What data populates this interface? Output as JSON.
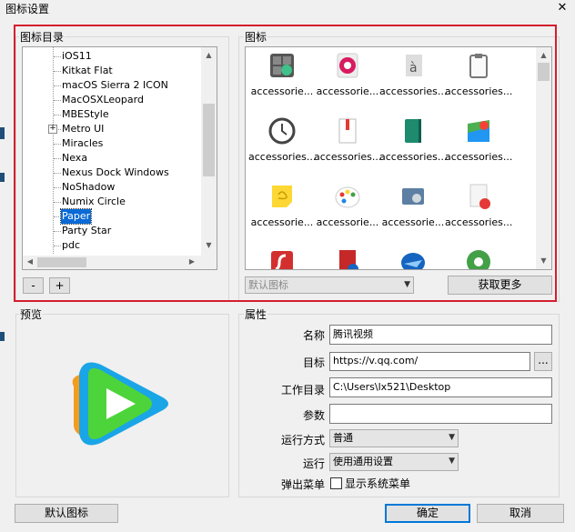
{
  "window": {
    "title": "图标设置",
    "close_glyph": "✕"
  },
  "catalog": {
    "label": "图标目录",
    "items": [
      "iOS11",
      "Kitkat Flat",
      "macOS Sierra 2 ICON",
      "MacOSXLeopard",
      "MBEStyle",
      "Metro UI",
      "Miracles",
      "Nexa",
      "Nexus Dock Windows",
      "NoShadow",
      "Numix Circle",
      "Paper",
      "Party Star",
      "pdc"
    ],
    "selected_index": 11,
    "expandable_index": 5,
    "remove_label": "-",
    "add_label": "+"
  },
  "icons": {
    "label": "图标",
    "cells": [
      "accessorie...",
      "accessorie...",
      "accessories...",
      "accessories...",
      "accessories...",
      "accessories...",
      "accessories...",
      "accessories...",
      "accessorie...",
      "accessorie...",
      "accessorie...",
      "accessories..."
    ],
    "icon_names": [
      "calculator-icon",
      "screen-record-icon",
      "character-map-icon",
      "clipboard-icon",
      "clock-icon",
      "notebook-icon",
      "green-book-icon",
      "maps-icon",
      "sticky-note-icon",
      "palette-icon",
      "screenshot-icon",
      "document-edit-icon",
      "flash-icon",
      "document-globe-icon",
      "shark-icon",
      "app-icon"
    ],
    "dropdown_value": "默认图标",
    "get_more_label": "获取更多"
  },
  "preview": {
    "label": "预览",
    "icon_name": "tencent-video-play-icon"
  },
  "properties": {
    "label": "属性",
    "name_label": "名称",
    "name_value": "腾讯视频",
    "target_label": "目标",
    "target_value": "https://v.qq.com/",
    "browse_label": "...",
    "workdir_label": "工作目录",
    "workdir_value": "C:\\Users\\lx521\\Desktop",
    "params_label": "参数",
    "params_value": "",
    "runmode_label": "运行方式",
    "runmode_value": "普通",
    "run_label": "运行",
    "run_value": "使用通用设置",
    "popup_label": "弹出菜单",
    "popup_checkbox_label": "显示系统菜单",
    "popup_checked": false
  },
  "footer": {
    "default_icon_label": "默认图标",
    "ok_label": "确定",
    "cancel_label": "取消"
  },
  "colors": {
    "selection": "#0a6ad6",
    "highlight_border": "#d41e2d",
    "primary_border": "#0078d7"
  }
}
